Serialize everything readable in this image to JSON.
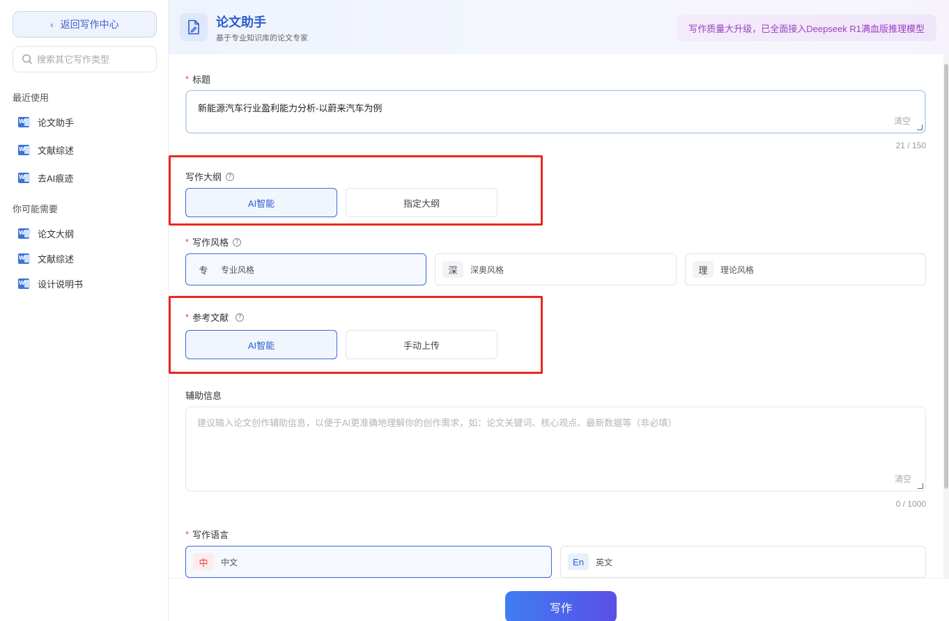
{
  "sidebar": {
    "back_label": "返回写作中心",
    "search_placeholder": "搜索其它写作类型",
    "recent_title": "最近使用",
    "recent_items": [
      {
        "label": "论文助手"
      },
      {
        "label": "文献综述"
      },
      {
        "label": "去AI痕迹"
      }
    ],
    "suggest_title": "你可能需要",
    "suggest_items": [
      {
        "label": "论文大纲"
      },
      {
        "label": "文献综述"
      },
      {
        "label": "设计说明书"
      }
    ]
  },
  "header": {
    "title": "论文助手",
    "subtitle": "基于专业知识库的论文专家",
    "promo": "写作质量大升级，已全面接入Deepseek R1满血版推理模型"
  },
  "form": {
    "title_label": "标题",
    "title_value": "新能源汽车行业盈利能力分析-以蔚来汽车为例",
    "clear_label": "清空",
    "title_counter": "21 / 150",
    "outline_label": "写作大纲",
    "outline_options": [
      "AI智能",
      "指定大纲"
    ],
    "outline_selected": "AI智能",
    "style_label": "写作风格",
    "styles": [
      {
        "badge": "专",
        "label": "专业风格"
      },
      {
        "badge": "深",
        "label": "深奥风格"
      },
      {
        "badge": "理",
        "label": "理论风格"
      }
    ],
    "style_selected": "专业风格",
    "ref_label": "参考文献",
    "ref_options": [
      "AI智能",
      "手动上传"
    ],
    "ref_selected": "AI智能",
    "aux_label": "辅助信息",
    "aux_placeholder": "建议输入论文创作辅助信息，以便于AI更准确地理解你的创作需求，如：论文关键词、核心观点、最新数据等（非必填）",
    "aux_counter": "0 / 1000",
    "lang_label": "写作语言",
    "languages": [
      {
        "badge": "中",
        "label": "中文"
      },
      {
        "badge": "En",
        "label": "英文"
      }
    ],
    "lang_selected": "中文"
  },
  "footer": {
    "write_label": "写作"
  },
  "colors": {
    "accent": "#2a5bd0",
    "highlight_box": "#e8281f",
    "promo_text": "#9a3fc2"
  }
}
